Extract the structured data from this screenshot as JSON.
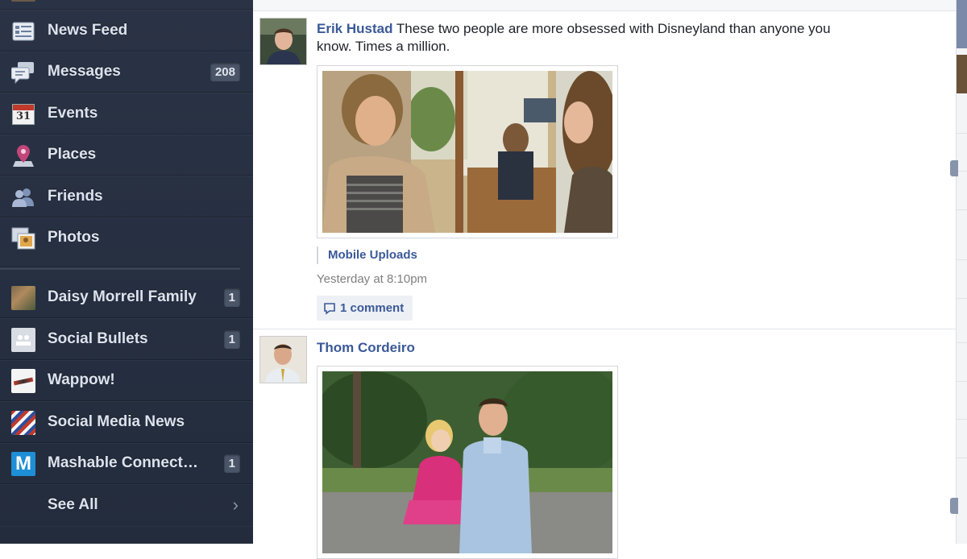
{
  "sidebar": {
    "items": [
      {
        "label": "",
        "icon": "profile-thumb-icon"
      },
      {
        "label": "News Feed",
        "icon": "news-feed-icon"
      },
      {
        "label": "Messages",
        "icon": "messages-icon",
        "badge": "208"
      },
      {
        "label": "Events",
        "icon": "calendar-icon",
        "icon_text": "31"
      },
      {
        "label": "Places",
        "icon": "map-pin-icon"
      },
      {
        "label": "Friends",
        "icon": "friends-icon"
      },
      {
        "label": "Photos",
        "icon": "photos-icon"
      }
    ],
    "groups": [
      {
        "label": "Daisy Morrell Family",
        "icon": "group-photo-icon",
        "badge": "1"
      },
      {
        "label": "Social Bullets",
        "icon": "group-default-icon",
        "badge": "1"
      },
      {
        "label": "Wappow!",
        "icon": "wappow-logo-icon"
      },
      {
        "label": "Social Media News",
        "icon": "flag-logo-icon"
      },
      {
        "label": "Mashable Connect…",
        "icon": "mashable-logo-icon",
        "icon_text": "M",
        "badge": "1"
      }
    ],
    "see_all": {
      "label": "See All",
      "chevron": "›"
    }
  },
  "feed": {
    "posts": [
      {
        "author": "Erik Hustad",
        "text": " These two people are more obsessed with Disneyland than anyone you know. Times a million.",
        "album": "Mobile Uploads",
        "timestamp": "Yesterday at 8:10pm",
        "comments": "1 comment"
      },
      {
        "author": "Thom Cordeiro",
        "text": ""
      }
    ]
  },
  "colors": {
    "sidebar_bg": "#262f41",
    "link": "#3b5998",
    "badge_bg": "#4a5568"
  }
}
